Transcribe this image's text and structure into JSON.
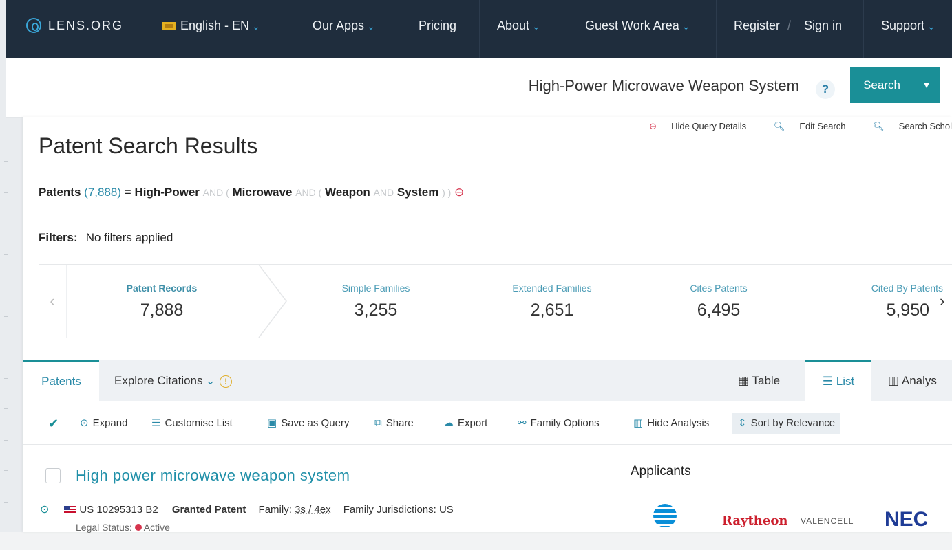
{
  "nav": {
    "logo_text": "LENS.ORG",
    "language": "English - EN",
    "our_apps": "Our Apps",
    "pricing": "Pricing",
    "about": "About",
    "guest_work_area": "Guest Work Area",
    "register": "Register",
    "separator": "/",
    "sign_in": "Sign in",
    "support": "Support"
  },
  "search": {
    "query": "High-Power Microwave Weapon System",
    "help": "?",
    "button": "Search",
    "dropdown": "▼"
  },
  "query_actions": {
    "hide_details": "Hide Query Details",
    "edit_search": "Edit Search",
    "search_scholarly": "Search Schol"
  },
  "page_title": "Patent Search Results",
  "query_line": {
    "label": "Patents",
    "count": "(7,888)",
    "equals": "=",
    "term1": "High-Power",
    "and1": "AND (",
    "term2": "Microwave",
    "and2": "AND (",
    "term3": "Weapon",
    "and3": "AND",
    "term4": "System",
    "close": ") )"
  },
  "filters": {
    "label": "Filters:",
    "value": "No filters applied"
  },
  "stats": [
    {
      "label": "Patent Records",
      "value": "7,888"
    },
    {
      "label": "Simple Families",
      "value": "3,255"
    },
    {
      "label": "Extended Families",
      "value": "2,651"
    },
    {
      "label": "Cites Patents",
      "value": "6,495"
    },
    {
      "label": "Cited By Patents",
      "value": "5,950"
    }
  ],
  "tabs": {
    "patents": "Patents",
    "explore_citations": "Explore Citations",
    "table": "Table",
    "list": "List",
    "analysis": "Analys"
  },
  "toolbar": {
    "expand": "Expand",
    "customise_list": "Customise List",
    "save_as_query": "Save as Query",
    "share": "Share",
    "export": "Export",
    "family_options": "Family Options",
    "hide_analysis": "Hide Analysis",
    "sort": "Sort by Relevance"
  },
  "result": {
    "title": "High power microwave weapon system",
    "number": "US 10295313 B2",
    "type": "Granted Patent",
    "family_label": "Family:",
    "family_value": "3s / 4ex",
    "jurisdictions": "Family Jurisdictions: US",
    "legal_status_label": "Legal Status:",
    "legal_status": "Active"
  },
  "applicants": {
    "title": "Applicants",
    "logos": [
      "AT&T",
      "Raytheon",
      "VALENCELL",
      "NEC"
    ]
  },
  "colors": {
    "nav_bg": "#1f2d3d",
    "accent_teal": "#1a8f97",
    "link_blue": "#2a8aa8",
    "status_red": "#d6344d"
  }
}
